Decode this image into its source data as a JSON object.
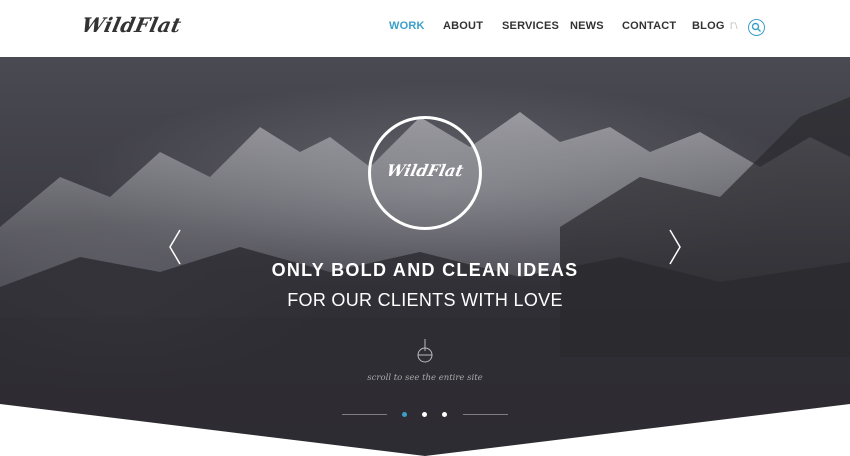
{
  "brand": {
    "logo_text": "WildFlat"
  },
  "nav": {
    "items": [
      {
        "label": "WORK"
      },
      {
        "label": "ABOUT"
      },
      {
        "label": "SERVICES"
      },
      {
        "label": "NEWS"
      },
      {
        "label": "CONTACT"
      },
      {
        "label": "BLOG"
      }
    ],
    "extra": "Γ\\"
  },
  "hero": {
    "emblem_text": "WildFlat",
    "headline": "ONLY BOLD AND CLEAN IDEAS",
    "subline": "FOR OUR CLIENTS WITH LOVE",
    "scroll_text": "scroll to see the entire site"
  },
  "colors": {
    "accent": "#3aa0c8",
    "text_dark": "#333333",
    "hero_bg": "#3b3a42"
  },
  "icons": {
    "search": "search-icon",
    "prev": "chevron-left-icon",
    "next": "chevron-right-icon",
    "scroll": "scroll-down-icon"
  },
  "slider": {
    "dot_count": 3,
    "active_index": 0
  }
}
